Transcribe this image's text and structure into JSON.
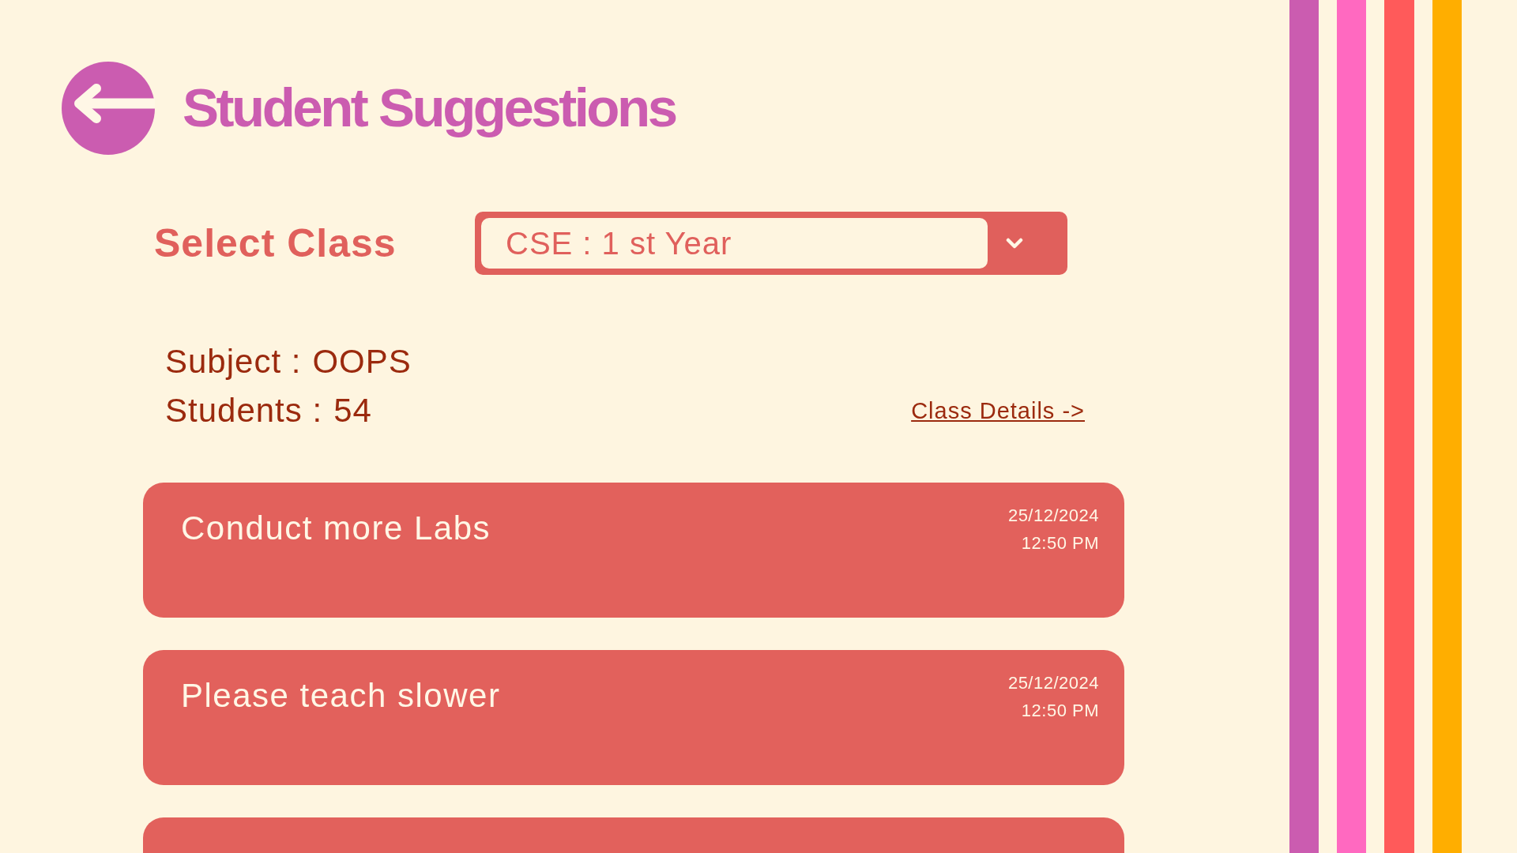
{
  "header": {
    "title": "Student Suggestions"
  },
  "class_select": {
    "label": "Select Class",
    "value": "CSE : 1 st Year"
  },
  "class_info": {
    "lines": [
      {
        "label": "Subject :",
        "value": "OOPS"
      },
      {
        "label": "Students :",
        "value": "54"
      }
    ],
    "details_link": "Class Details ->"
  },
  "suggestions": [
    {
      "kind": "full",
      "text": "Conduct more Labs",
      "date": "25/12/2024",
      "time": "12:50 PM"
    },
    {
      "kind": "full",
      "text": "Please teach slower",
      "date": "25/12/2024",
      "time": "12:50 PM"
    },
    {
      "kind": "cut_off"
    }
  ]
}
